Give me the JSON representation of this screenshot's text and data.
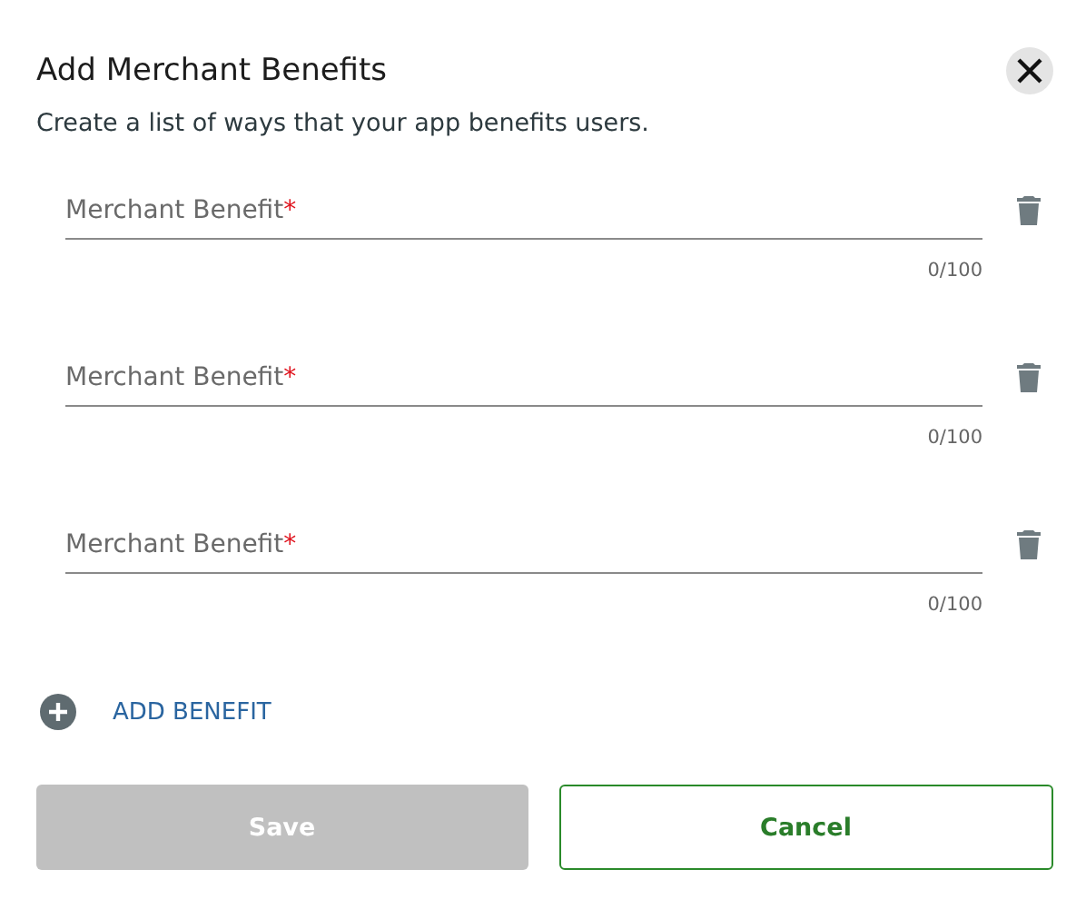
{
  "dialog": {
    "title": "Add Merchant Benefits",
    "subtitle": "Create a list of ways that your app benefits users."
  },
  "benefits": [
    {
      "placeholder": "Merchant Benefit",
      "required_mark": "*",
      "counter": "0/100"
    },
    {
      "placeholder": "Merchant Benefit",
      "required_mark": "*",
      "counter": "0/100"
    },
    {
      "placeholder": "Merchant Benefit",
      "required_mark": "*",
      "counter": "0/100"
    }
  ],
  "add_button": {
    "label": "ADD BENEFIT"
  },
  "buttons": [
    {
      "label": "Save",
      "kind": "primary",
      "disabled": true
    },
    {
      "label": "Cancel",
      "kind": "secondary",
      "disabled": false
    }
  ]
}
